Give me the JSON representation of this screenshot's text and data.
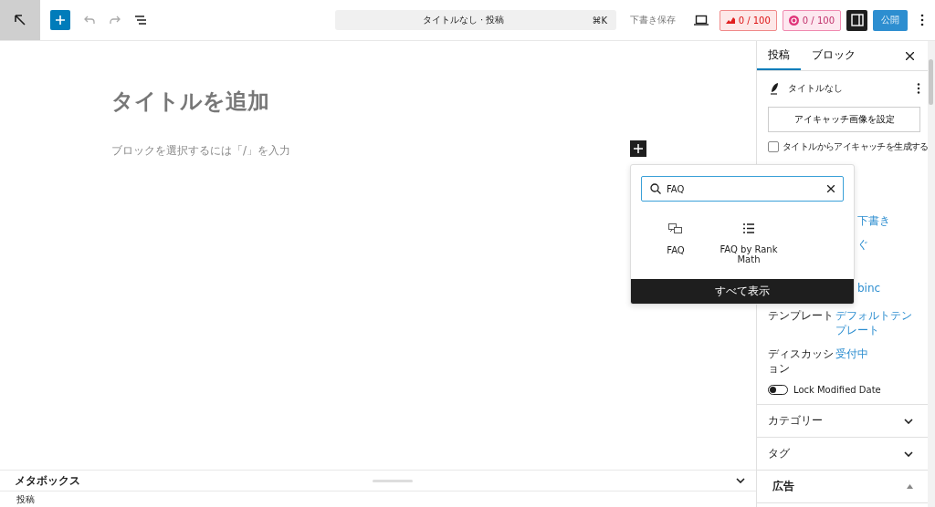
{
  "toolbar": {
    "title": "タイトルなし · 投稿",
    "shortcut": "⌘K",
    "save_draft": "下書き保存",
    "seo_score": "0 / 100",
    "readability_score": "0 / 100",
    "settings_on": true,
    "publish": "公開"
  },
  "editor": {
    "title_placeholder": "タイトルを追加",
    "block_placeholder": "ブロックを選択するには「/」を入力"
  },
  "inserter": {
    "search_value": "FAQ",
    "results": [
      {
        "label": "FAQ",
        "kind": "faq"
      },
      {
        "label": "FAQ by Rank Math",
        "kind": "list"
      }
    ],
    "browse_all": "すべて表示"
  },
  "sidebar": {
    "tabs": [
      {
        "label": "投稿",
        "selected": true
      },
      {
        "label": "ブロック",
        "selected": false
      }
    ],
    "post_title": "タイトルなし",
    "featured_image_button": "アイキャッチ画像を設定",
    "generate_checkbox": {
      "label": "タイトルからアイキャッチを生成する",
      "checked": false
    },
    "fields": [
      {
        "value": "下書き"
      },
      {
        "value": "ぐ"
      },
      {
        "value": "binc"
      },
      {
        "label": "テンプレート",
        "value": "デフォルトテンプレート"
      },
      {
        "label": "ディスカッション",
        "value": "受付中"
      }
    ],
    "lock_toggle": {
      "label": "Lock Modified Date",
      "on": false
    },
    "panels": [
      {
        "title": "カテゴリー",
        "expanded": false
      },
      {
        "title": "タグ",
        "expanded": false
      },
      {
        "title": "広告",
        "expanded": true
      }
    ]
  },
  "metabox": {
    "title": "メタボックス",
    "expanded": false
  },
  "breadcrumb": "投稿"
}
